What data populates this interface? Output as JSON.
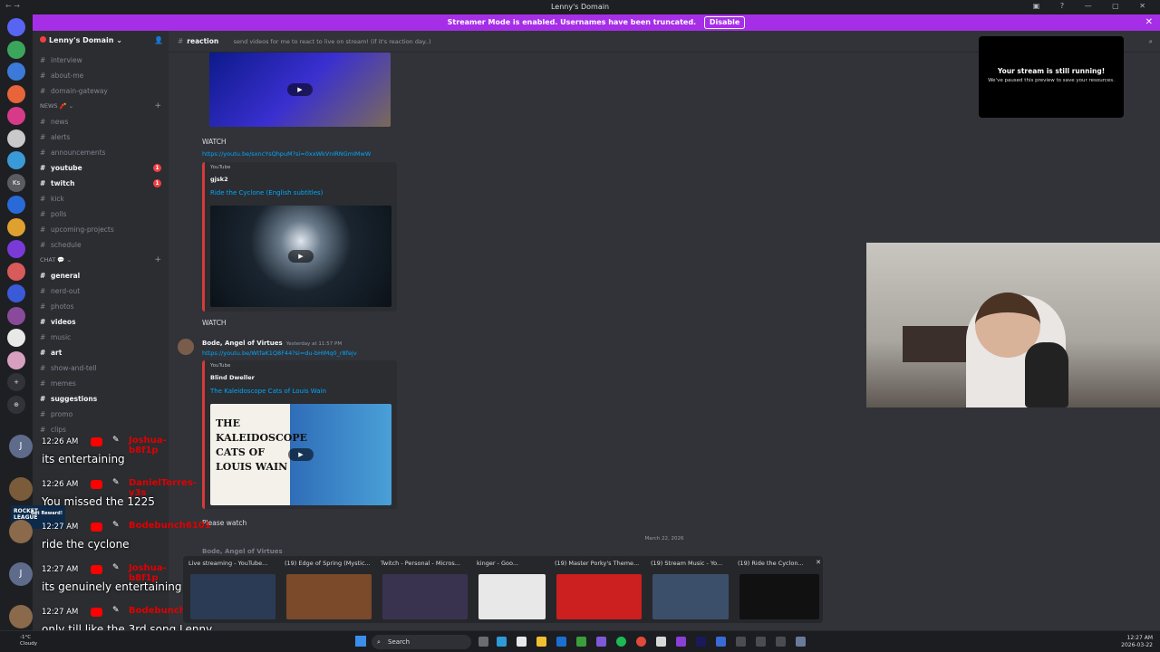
{
  "window": {
    "title": "Lenny's Domain",
    "nav": "← →",
    "controls": "▣ ? — ▢ ✕"
  },
  "banner": {
    "text": "Streamer Mode is enabled. Usernames have been truncated.",
    "button": "Disable",
    "close": "✕"
  },
  "servers": [
    "",
    "",
    "",
    "",
    "",
    "",
    "Ks",
    "",
    "",
    "",
    "",
    "",
    "",
    "",
    "",
    "+",
    "⊕"
  ],
  "guild": {
    "name": "Lenny's Domain ⌄",
    "invite_icon": "👤"
  },
  "channels": [
    {
      "type": "ch",
      "name": "interview"
    },
    {
      "type": "ch",
      "name": "about-me"
    },
    {
      "type": "ch",
      "name": "domain-gateway"
    },
    {
      "type": "cat",
      "name": "NEWS 🧨 ⌄"
    },
    {
      "type": "ch",
      "name": "news"
    },
    {
      "type": "ch",
      "name": "alerts"
    },
    {
      "type": "ch",
      "name": "announcements"
    },
    {
      "type": "ch",
      "name": "youtube",
      "bold": true,
      "badge": "1"
    },
    {
      "type": "ch",
      "name": "twitch",
      "bold": true,
      "badge": "1"
    },
    {
      "type": "ch",
      "name": "kick"
    },
    {
      "type": "ch",
      "name": "polls"
    },
    {
      "type": "ch",
      "name": "upcoming-projects"
    },
    {
      "type": "ch",
      "name": "schedule"
    },
    {
      "type": "cat",
      "name": "CHAT 💬 ⌄"
    },
    {
      "type": "ch",
      "name": "general",
      "bold": true
    },
    {
      "type": "ch",
      "name": "nerd-out"
    },
    {
      "type": "ch",
      "name": "photos"
    },
    {
      "type": "ch",
      "name": "videos",
      "bold": true
    },
    {
      "type": "ch",
      "name": "music"
    },
    {
      "type": "ch",
      "name": "art",
      "bold": true
    },
    {
      "type": "ch",
      "name": "show-and-tell"
    },
    {
      "type": "ch",
      "name": "memes"
    },
    {
      "type": "ch",
      "name": "suggestions",
      "bold": true
    },
    {
      "type": "ch",
      "name": "promo"
    },
    {
      "type": "ch",
      "name": "clips"
    }
  ],
  "header": {
    "channel": "reaction",
    "topic": "send videos for me to react to live on stream! (if it's reaction day..)"
  },
  "messages": {
    "watch1": "WATCH",
    "link1": "https://youtu.be/sxncYsQhpuM?si=0xxWkVnIRNGmIMwW",
    "embed1": {
      "provider": "YouTube",
      "author": "gjsk2",
      "title": "Ride the Cyclone (English subtitles)"
    },
    "watch2": "WATCH",
    "author2": "Bode, Angel of Virtues",
    "ts2": "Yesterday at 11:57 PM",
    "link2": "https://youtu.be/WtfaK1Q8F44?si=du-bHIMq0_r8fejv",
    "embed2": {
      "provider": "YouTube",
      "author": "Blind Dweller",
      "title": "The Kaleidoscope Cats of Louis Wain"
    },
    "thumb2_text": "THE KALEIDOSCOPE CATS OF LOUIS WAIN",
    "please": "Please watch",
    "date": "March 22, 2026",
    "author3": "Bode, Angel of Virtues"
  },
  "preview": {
    "title": "Your stream is still running!",
    "subtitle": "We've paused this preview to save your resources."
  },
  "chat": [
    {
      "avatar": "J",
      "time": "12:26 AM",
      "name": "Joshua-b8f1p",
      "text": "its entertaining"
    },
    {
      "avatar": "",
      "time": "12:26 AM",
      "name": "DanielTorres-y3s",
      "text": "You missed the 1225"
    },
    {
      "avatar": "",
      "time": "12:27 AM",
      "name": "Bodebunch6101",
      "text": "ride the cyclone"
    },
    {
      "avatar": "J",
      "time": "12:27 AM",
      "name": "Joshua-b8f1p",
      "text": "its genuinely entertaining"
    },
    {
      "avatar": "",
      "time": "12:27 AM",
      "name": "Bodebunch6101",
      "text": "only till like the 3rd song Lenny"
    }
  ],
  "rl_badge": {
    "line1": "ROCKET LEAGUE",
    "reward": "Get Reward!"
  },
  "thumbnails": [
    {
      "title": "Live streaming - YouTube...",
      "color": "#2b3b55"
    },
    {
      "title": "(19) Edge of Spring (Mystic...",
      "color": "#7a4a2a"
    },
    {
      "title": "Twitch - Personal - Micros...",
      "color": "#3a3350"
    },
    {
      "title": "kinger - Goo...",
      "color": "#e8e8e8"
    },
    {
      "title": "(19) Master Porky's Theme...",
      "color": "#cc1f1f"
    },
    {
      "title": "(19) Stream Music - Yo...",
      "color": "#3c4f6a"
    },
    {
      "title": "(19) Ride the Cyclon...",
      "color": "#111111"
    }
  ],
  "thumb_close": "✕",
  "taskbar": {
    "weather_temp": "-1°C",
    "weather_desc": "Cloudy",
    "search": "Search",
    "time": "12:27 AM",
    "date": "2026-03-22"
  },
  "colors": {
    "banner": "#a72ee7",
    "accent_link": "#00a8fc",
    "embed_border": "#d63a3a"
  }
}
